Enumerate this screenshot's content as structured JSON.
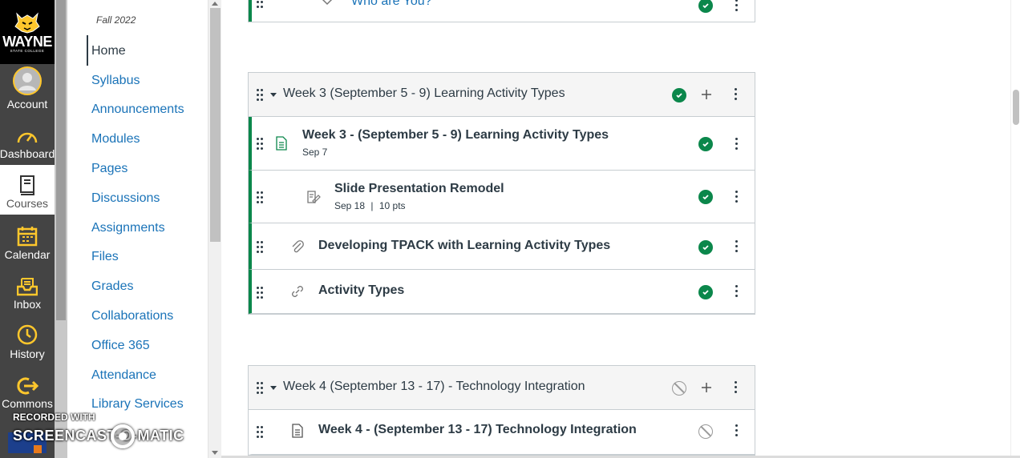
{
  "global_nav": {
    "logo": {
      "wordmark": "WAYNE",
      "subtitle": "STATE COLLEGE"
    },
    "items": [
      {
        "label": "Account",
        "icon": "account-avatar-icon"
      },
      {
        "label": "Dashboard",
        "icon": "dashboard-gauge-icon"
      },
      {
        "label": "Courses",
        "icon": "courses-book-icon",
        "active": true
      },
      {
        "label": "Calendar",
        "icon": "calendar-icon"
      },
      {
        "label": "Inbox",
        "icon": "inbox-icon"
      },
      {
        "label": "History",
        "icon": "history-clock-icon"
      },
      {
        "label": "Commons",
        "icon": "commons-arrow-icon"
      }
    ],
    "colors": {
      "background": "#444444",
      "icon": "#ffc72c",
      "active_bg": "#ffffff"
    }
  },
  "course_nav": {
    "term": "Fall 2022",
    "items": [
      {
        "label": "Home",
        "active": true
      },
      {
        "label": "Syllabus"
      },
      {
        "label": "Announcements"
      },
      {
        "label": "Modules"
      },
      {
        "label": "Pages"
      },
      {
        "label": "Discussions"
      },
      {
        "label": "Assignments"
      },
      {
        "label": "Files"
      },
      {
        "label": "Grades"
      },
      {
        "label": "Collaborations"
      },
      {
        "label": "Office 365"
      },
      {
        "label": "Attendance"
      },
      {
        "label": "Library Services"
      }
    ],
    "link_color": "#1a73b8"
  },
  "modules": {
    "previous_item": {
      "title": "Who are You?"
    },
    "week3": {
      "title": "Week 3 (September 5 - 9) Learning Activity Types",
      "published": true,
      "items": [
        {
          "type": "page-icon",
          "title": "Week 3 - (September 5 - 9) Learning Activity Types",
          "meta": "Sep 7",
          "published": true
        },
        {
          "type": "assignment-icon",
          "title": "Slide Presentation Remodel",
          "due": "Sep 18",
          "points": "10 pts",
          "published": true
        },
        {
          "type": "attachment-icon",
          "title": "Developing TPACK with Learning Activity Types",
          "published": true
        },
        {
          "type": "link-icon",
          "title": "Activity Types",
          "published": true
        }
      ]
    },
    "week4": {
      "title": "Week 4 (September 13 - 17) - Technology Integration",
      "published": false,
      "items": [
        {
          "type": "page-icon",
          "title": "Week 4 - (September 13 - 17) Technology Integration",
          "published": false
        }
      ]
    },
    "published_color": "#0b874b"
  },
  "watermark": {
    "recorded_with": "RECORDED WITH",
    "brand": "SCREENCAST-O-MATIC"
  }
}
